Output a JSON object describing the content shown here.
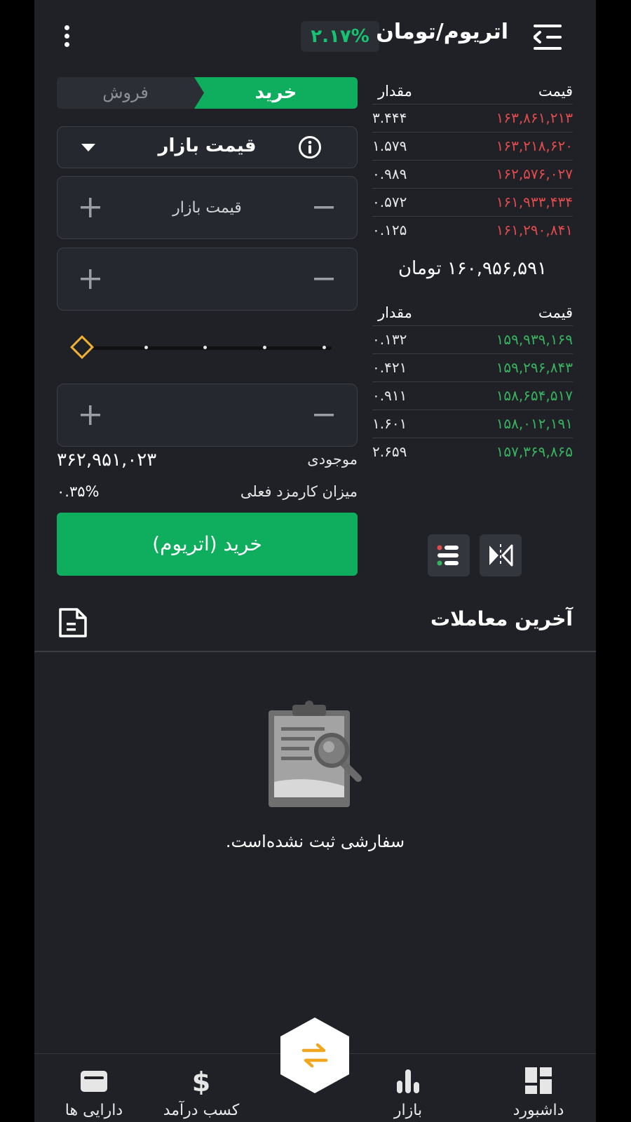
{
  "header": {
    "title": "اتریوم/تومان",
    "change_badge": "۲.۱۷%",
    "badge_color": "#17c270"
  },
  "order_form": {
    "tabs": {
      "buy": "خرید",
      "sell": "فروش"
    },
    "order_type": "قیمت بازار",
    "price_field": {
      "value": "قیمت بازار"
    },
    "amount_field": {
      "value": ""
    },
    "total_field": {
      "value": ""
    },
    "slider_percent": 0,
    "balance": {
      "label": "موجودی",
      "value": "۳۶۲,۹۵۱,۰۲۳"
    },
    "fee": {
      "label": "میزان کارمزد فعلی",
      "value": "۰.۳۵%"
    },
    "submit_label": "خرید (اتریوم)",
    "accent_color": "#0fae5e"
  },
  "order_book": {
    "sell": {
      "headers": {
        "price": "قیمت",
        "qty": "مقدار"
      },
      "rows": [
        {
          "price": "۱۶۳,۸۶۱,۲۱۳",
          "qty": "۳.۴۴۴"
        },
        {
          "price": "۱۶۳,۲۱۸,۶۲۰",
          "qty": "۱.۵۷۹"
        },
        {
          "price": "۱۶۲,۵۷۶,۰۲۷",
          "qty": "۰.۹۸۹"
        },
        {
          "price": "۱۶۱,۹۳۳,۴۳۴",
          "qty": "۰.۵۷۲"
        },
        {
          "price": "۱۶۱,۲۹۰,۸۴۱",
          "qty": "۰.۱۲۵"
        }
      ]
    },
    "last_price": "۱۶۰,۹۵۶,۵۹۱ تومان",
    "buy": {
      "headers": {
        "price": "قیمت",
        "qty": "مقدار"
      },
      "rows": [
        {
          "price": "۱۵۹,۹۳۹,۱۶۹",
          "qty": "۰.۱۳۲"
        },
        {
          "price": "۱۵۹,۲۹۶,۸۴۳",
          "qty": "۰.۴۲۱"
        },
        {
          "price": "۱۵۸,۶۵۴,۵۱۷",
          "qty": "۰.۹۱۱"
        },
        {
          "price": "۱۵۸,۰۱۲,۱۹۱",
          "qty": "۱.۶۰۱"
        },
        {
          "price": "۱۵۷,۳۶۹,۸۶۵",
          "qty": "۲.۶۵۹"
        }
      ]
    },
    "sell_color": "#e14b4b",
    "buy_color": "#38b25e"
  },
  "recent_trades": {
    "title": "آخرین معاملات",
    "empty_message": "سفارشی ثبت نشده‌است."
  },
  "bottom_nav": {
    "dashboard": "داشبورد",
    "market": "بازار",
    "earn": "کسب درآمد",
    "assets": "دارایی ها"
  }
}
